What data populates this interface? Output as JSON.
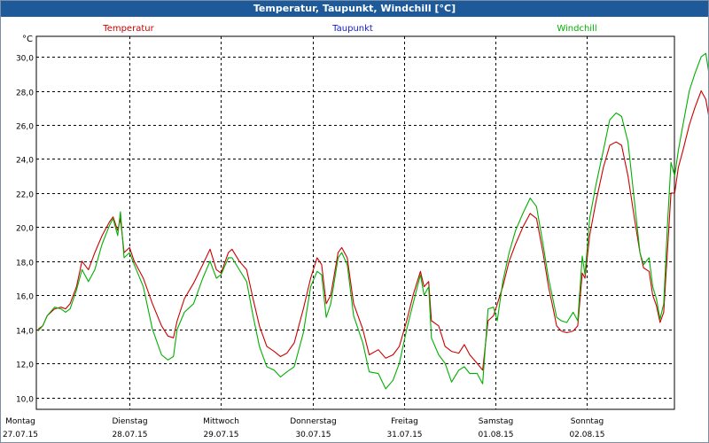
{
  "window": {
    "title": "Temperatur, Taupunkt, Windchill [°C]"
  },
  "chart_data": {
    "type": "line",
    "title": "Temperatur, Taupunkt, Windchill [°C]",
    "ylabel": "°C",
    "xlabel": "",
    "ylim": [
      9.3,
      31.2
    ],
    "yticks": [
      "10,0",
      "12,0",
      "14,0",
      "16,0",
      "18,0",
      "20,0",
      "22,0",
      "24,0",
      "26,0",
      "28,0",
      "30,0"
    ],
    "ytick_values": [
      10,
      12,
      14,
      16,
      18,
      20,
      22,
      24,
      26,
      28,
      30
    ],
    "xlim": [
      0,
      7.05
    ],
    "days": [
      {
        "weekday": "Montag",
        "date": "27.07.15",
        "x": 0
      },
      {
        "weekday": "Dienstag",
        "date": "28.07.15",
        "x": 1
      },
      {
        "weekday": "Mittwoch",
        "date": "29.07.15",
        "x": 2
      },
      {
        "weekday": "Donnerstag",
        "date": "30.07.15",
        "x": 3
      },
      {
        "weekday": "Freitag",
        "date": "31.07.15",
        "x": 4
      },
      {
        "weekday": "Samstag",
        "date": "01.08.15",
        "x": 5
      },
      {
        "weekday": "Sonntag",
        "date": "02.08.15",
        "x": 6
      }
    ],
    "grid": true,
    "legend_position": "top",
    "series": [
      {
        "name": "Temperatur",
        "color": "#cc0000",
        "points": [
          [
            0,
            14.0
          ],
          [
            0.05,
            14.2
          ],
          [
            0.1,
            14.8
          ],
          [
            0.18,
            15.2
          ],
          [
            0.25,
            15.3
          ],
          [
            0.3,
            15.2
          ],
          [
            0.35,
            15.5
          ],
          [
            0.42,
            16.5
          ],
          [
            0.48,
            18.0
          ],
          [
            0.55,
            17.5
          ],
          [
            0.62,
            18.5
          ],
          [
            0.7,
            19.5
          ],
          [
            0.78,
            20.3
          ],
          [
            0.82,
            20.6
          ],
          [
            0.87,
            19.8
          ],
          [
            0.9,
            20.5
          ],
          [
            0.94,
            18.5
          ],
          [
            1.0,
            18.8
          ],
          [
            1.05,
            18.0
          ],
          [
            1.15,
            17.0
          ],
          [
            1.25,
            15.5
          ],
          [
            1.35,
            14.2
          ],
          [
            1.42,
            13.6
          ],
          [
            1.48,
            13.5
          ],
          [
            1.52,
            14.5
          ],
          [
            1.6,
            15.8
          ],
          [
            1.7,
            16.7
          ],
          [
            1.8,
            17.8
          ],
          [
            1.88,
            18.7
          ],
          [
            1.95,
            17.5
          ],
          [
            2.0,
            17.3
          ],
          [
            2.08,
            18.5
          ],
          [
            2.12,
            18.7
          ],
          [
            2.2,
            18.0
          ],
          [
            2.28,
            17.5
          ],
          [
            2.35,
            15.8
          ],
          [
            2.42,
            14.2
          ],
          [
            2.5,
            13.0
          ],
          [
            2.58,
            12.7
          ],
          [
            2.65,
            12.4
          ],
          [
            2.72,
            12.6
          ],
          [
            2.8,
            13.2
          ],
          [
            2.9,
            15.2
          ],
          [
            2.98,
            17.0
          ],
          [
            3.05,
            18.2
          ],
          [
            3.1,
            17.8
          ],
          [
            3.15,
            15.5
          ],
          [
            3.2,
            16.0
          ],
          [
            3.28,
            18.5
          ],
          [
            3.32,
            18.8
          ],
          [
            3.38,
            18.2
          ],
          [
            3.45,
            15.5
          ],
          [
            3.55,
            14.0
          ],
          [
            3.62,
            12.5
          ],
          [
            3.72,
            12.8
          ],
          [
            3.8,
            12.3
          ],
          [
            3.88,
            12.5
          ],
          [
            3.95,
            13.0
          ],
          [
            4.03,
            14.5
          ],
          [
            4.1,
            16.0
          ],
          [
            4.18,
            17.4
          ],
          [
            4.22,
            16.5
          ],
          [
            4.27,
            16.8
          ],
          [
            4.3,
            14.5
          ],
          [
            4.38,
            14.2
          ],
          [
            4.45,
            13.0
          ],
          [
            4.52,
            12.7
          ],
          [
            4.6,
            12.6
          ],
          [
            4.66,
            13.1
          ],
          [
            4.72,
            12.5
          ],
          [
            4.8,
            12.0
          ],
          [
            4.86,
            11.6
          ],
          [
            4.92,
            14.5
          ],
          [
            4.98,
            14.8
          ],
          [
            5.08,
            16.5
          ],
          [
            5.15,
            18.0
          ],
          [
            5.22,
            19.0
          ],
          [
            5.3,
            20.0
          ],
          [
            5.38,
            20.8
          ],
          [
            5.45,
            20.5
          ],
          [
            5.52,
            18.5
          ],
          [
            5.58,
            16.5
          ],
          [
            5.62,
            15.5
          ],
          [
            5.67,
            14.2
          ],
          [
            5.72,
            13.9
          ],
          [
            5.78,
            13.8
          ],
          [
            5.85,
            13.9
          ],
          [
            5.9,
            14.2
          ],
          [
            5.95,
            17.3
          ],
          [
            5.98,
            17.0
          ],
          [
            6.03,
            19.5
          ],
          [
            6.1,
            21.5
          ],
          [
            6.18,
            23.5
          ],
          [
            6.25,
            24.8
          ],
          [
            6.32,
            25.0
          ],
          [
            6.38,
            24.8
          ],
          [
            6.45,
            23.0
          ],
          [
            6.52,
            20.5
          ],
          [
            6.58,
            18.5
          ],
          [
            6.62,
            17.6
          ],
          [
            6.68,
            17.4
          ],
          [
            6.72,
            16.0
          ],
          [
            6.76,
            15.4
          ],
          [
            6.8,
            14.4
          ],
          [
            6.84,
            15.0
          ],
          [
            6.88,
            18.5
          ],
          [
            6.92,
            22.0
          ],
          [
            6.96,
            22.0
          ],
          [
            7.0,
            23.5
          ],
          [
            7.05,
            24.5
          ],
          [
            7.12,
            26.0
          ],
          [
            7.18,
            27.0
          ],
          [
            7.25,
            28.0
          ],
          [
            7.3,
            27.5
          ],
          [
            7.35,
            26.0
          ],
          [
            7.42,
            24.0
          ],
          [
            7.48,
            23.3
          ]
        ]
      },
      {
        "name": "Taupunkt",
        "color": "#1a1acc",
        "points": []
      },
      {
        "name": "Windchill",
        "color": "#00b000",
        "points": [
          [
            0,
            13.9
          ],
          [
            0.05,
            14.2
          ],
          [
            0.1,
            14.8
          ],
          [
            0.18,
            15.3
          ],
          [
            0.25,
            15.2
          ],
          [
            0.3,
            15.0
          ],
          [
            0.35,
            15.2
          ],
          [
            0.42,
            16.3
          ],
          [
            0.48,
            17.5
          ],
          [
            0.55,
            16.8
          ],
          [
            0.62,
            17.5
          ],
          [
            0.7,
            19.0
          ],
          [
            0.78,
            20.1
          ],
          [
            0.82,
            20.5
          ],
          [
            0.87,
            19.5
          ],
          [
            0.9,
            20.9
          ],
          [
            0.94,
            18.2
          ],
          [
            1.0,
            18.5
          ],
          [
            1.05,
            17.8
          ],
          [
            1.15,
            16.5
          ],
          [
            1.25,
            14.0
          ],
          [
            1.35,
            12.5
          ],
          [
            1.42,
            12.2
          ],
          [
            1.48,
            12.4
          ],
          [
            1.52,
            14.0
          ],
          [
            1.6,
            15.0
          ],
          [
            1.7,
            15.5
          ],
          [
            1.8,
            17.0
          ],
          [
            1.88,
            18.0
          ],
          [
            1.95,
            17.0
          ],
          [
            2.0,
            17.2
          ],
          [
            2.08,
            18.2
          ],
          [
            2.12,
            18.2
          ],
          [
            2.2,
            17.5
          ],
          [
            2.28,
            16.8
          ],
          [
            2.35,
            14.8
          ],
          [
            2.42,
            13.0
          ],
          [
            2.5,
            11.8
          ],
          [
            2.58,
            11.6
          ],
          [
            2.65,
            11.2
          ],
          [
            2.72,
            11.5
          ],
          [
            2.8,
            11.8
          ],
          [
            2.9,
            13.8
          ],
          [
            2.98,
            16.5
          ],
          [
            3.05,
            17.4
          ],
          [
            3.1,
            17.2
          ],
          [
            3.15,
            14.7
          ],
          [
            3.2,
            15.5
          ],
          [
            3.28,
            18.2
          ],
          [
            3.32,
            18.5
          ],
          [
            3.38,
            17.8
          ],
          [
            3.45,
            14.8
          ],
          [
            3.55,
            13.2
          ],
          [
            3.62,
            11.5
          ],
          [
            3.72,
            11.4
          ],
          [
            3.8,
            10.5
          ],
          [
            3.88,
            11.0
          ],
          [
            3.95,
            12.0
          ],
          [
            4.03,
            14.0
          ],
          [
            4.1,
            15.5
          ],
          [
            4.18,
            17.2
          ],
          [
            4.22,
            16.0
          ],
          [
            4.27,
            16.5
          ],
          [
            4.3,
            13.5
          ],
          [
            4.38,
            12.5
          ],
          [
            4.45,
            12.0
          ],
          [
            4.52,
            10.9
          ],
          [
            4.6,
            11.6
          ],
          [
            4.66,
            11.8
          ],
          [
            4.72,
            11.4
          ],
          [
            4.8,
            11.4
          ],
          [
            4.86,
            10.8
          ],
          [
            4.92,
            15.2
          ],
          [
            4.98,
            15.3
          ],
          [
            5.02,
            14.5
          ],
          [
            5.08,
            16.8
          ],
          [
            5.15,
            18.5
          ],
          [
            5.22,
            19.8
          ],
          [
            5.3,
            20.8
          ],
          [
            5.38,
            21.7
          ],
          [
            5.45,
            21.2
          ],
          [
            5.52,
            19.0
          ],
          [
            5.58,
            17.0
          ],
          [
            5.62,
            16.0
          ],
          [
            5.67,
            14.7
          ],
          [
            5.72,
            14.5
          ],
          [
            5.78,
            14.4
          ],
          [
            5.85,
            15.0
          ],
          [
            5.9,
            14.5
          ],
          [
            5.95,
            18.3
          ],
          [
            5.98,
            17.2
          ],
          [
            6.03,
            20.5
          ],
          [
            6.1,
            22.5
          ],
          [
            6.18,
            24.5
          ],
          [
            6.25,
            26.3
          ],
          [
            6.32,
            26.7
          ],
          [
            6.38,
            26.5
          ],
          [
            6.45,
            25.0
          ],
          [
            6.52,
            21.5
          ],
          [
            6.58,
            18.5
          ],
          [
            6.62,
            17.8
          ],
          [
            6.68,
            18.2
          ],
          [
            6.72,
            16.5
          ],
          [
            6.76,
            15.8
          ],
          [
            6.8,
            14.6
          ],
          [
            6.84,
            15.5
          ],
          [
            6.88,
            20.0
          ],
          [
            6.92,
            23.8
          ],
          [
            6.96,
            23.0
          ],
          [
            7.0,
            24.5
          ],
          [
            7.05,
            26.0
          ],
          [
            7.12,
            28.0
          ],
          [
            7.18,
            29.0
          ],
          [
            7.25,
            30.0
          ],
          [
            7.3,
            30.2
          ],
          [
            7.35,
            28.5
          ],
          [
            7.42,
            26.0
          ],
          [
            7.48,
            24.7
          ]
        ]
      }
    ]
  }
}
